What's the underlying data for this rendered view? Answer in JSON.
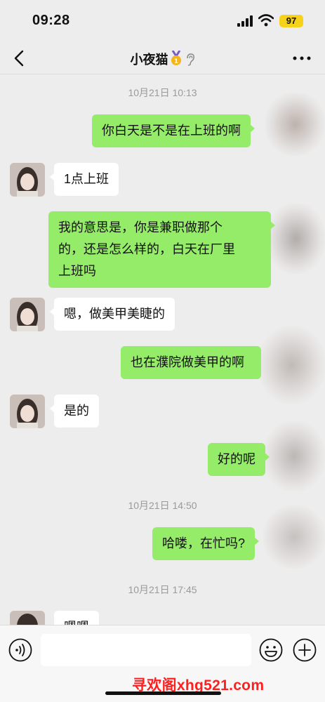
{
  "status_bar": {
    "time": "09:28",
    "battery": "97"
  },
  "nav": {
    "title": "小夜猫"
  },
  "timestamps": [
    "10月21日 10:13",
    "10月21日 14:50",
    "10月21日 17:45"
  ],
  "messages": [
    {
      "sender": "me",
      "lines": [
        "你白天是不是在上班的啊"
      ]
    },
    {
      "sender": "contact",
      "lines": [
        "1点上班"
      ]
    },
    {
      "sender": "me",
      "lines": [
        "我的意思是，你是兼职做那个",
        "的，还是怎么样的，白天在厂里",
        "上班吗"
      ]
    },
    {
      "sender": "contact",
      "lines": [
        "嗯，做美甲美睫的"
      ]
    },
    {
      "sender": "me",
      "lines": [
        "也在濮院做美甲的啊"
      ]
    },
    {
      "sender": "contact",
      "lines": [
        "是的"
      ]
    },
    {
      "sender": "me",
      "lines": [
        "好的呢"
      ]
    },
    {
      "sender": "me",
      "lines": [
        "哈喽，在忙吗?"
      ]
    },
    {
      "sender": "contact",
      "lines": [
        "嗯嗯"
      ]
    }
  ],
  "input": {
    "value": ""
  },
  "watermark": "寻欢阁xhg521.com",
  "colors": {
    "my_bubble": "#95ec69",
    "their_bubble": "#ffffff",
    "background": "#ededed",
    "watermark": "#ff1f1f"
  },
  "icons": [
    "back-icon",
    "medal-icon",
    "ear-icon",
    "more-icon",
    "voice-icon",
    "emoji-icon",
    "plus-icon"
  ]
}
